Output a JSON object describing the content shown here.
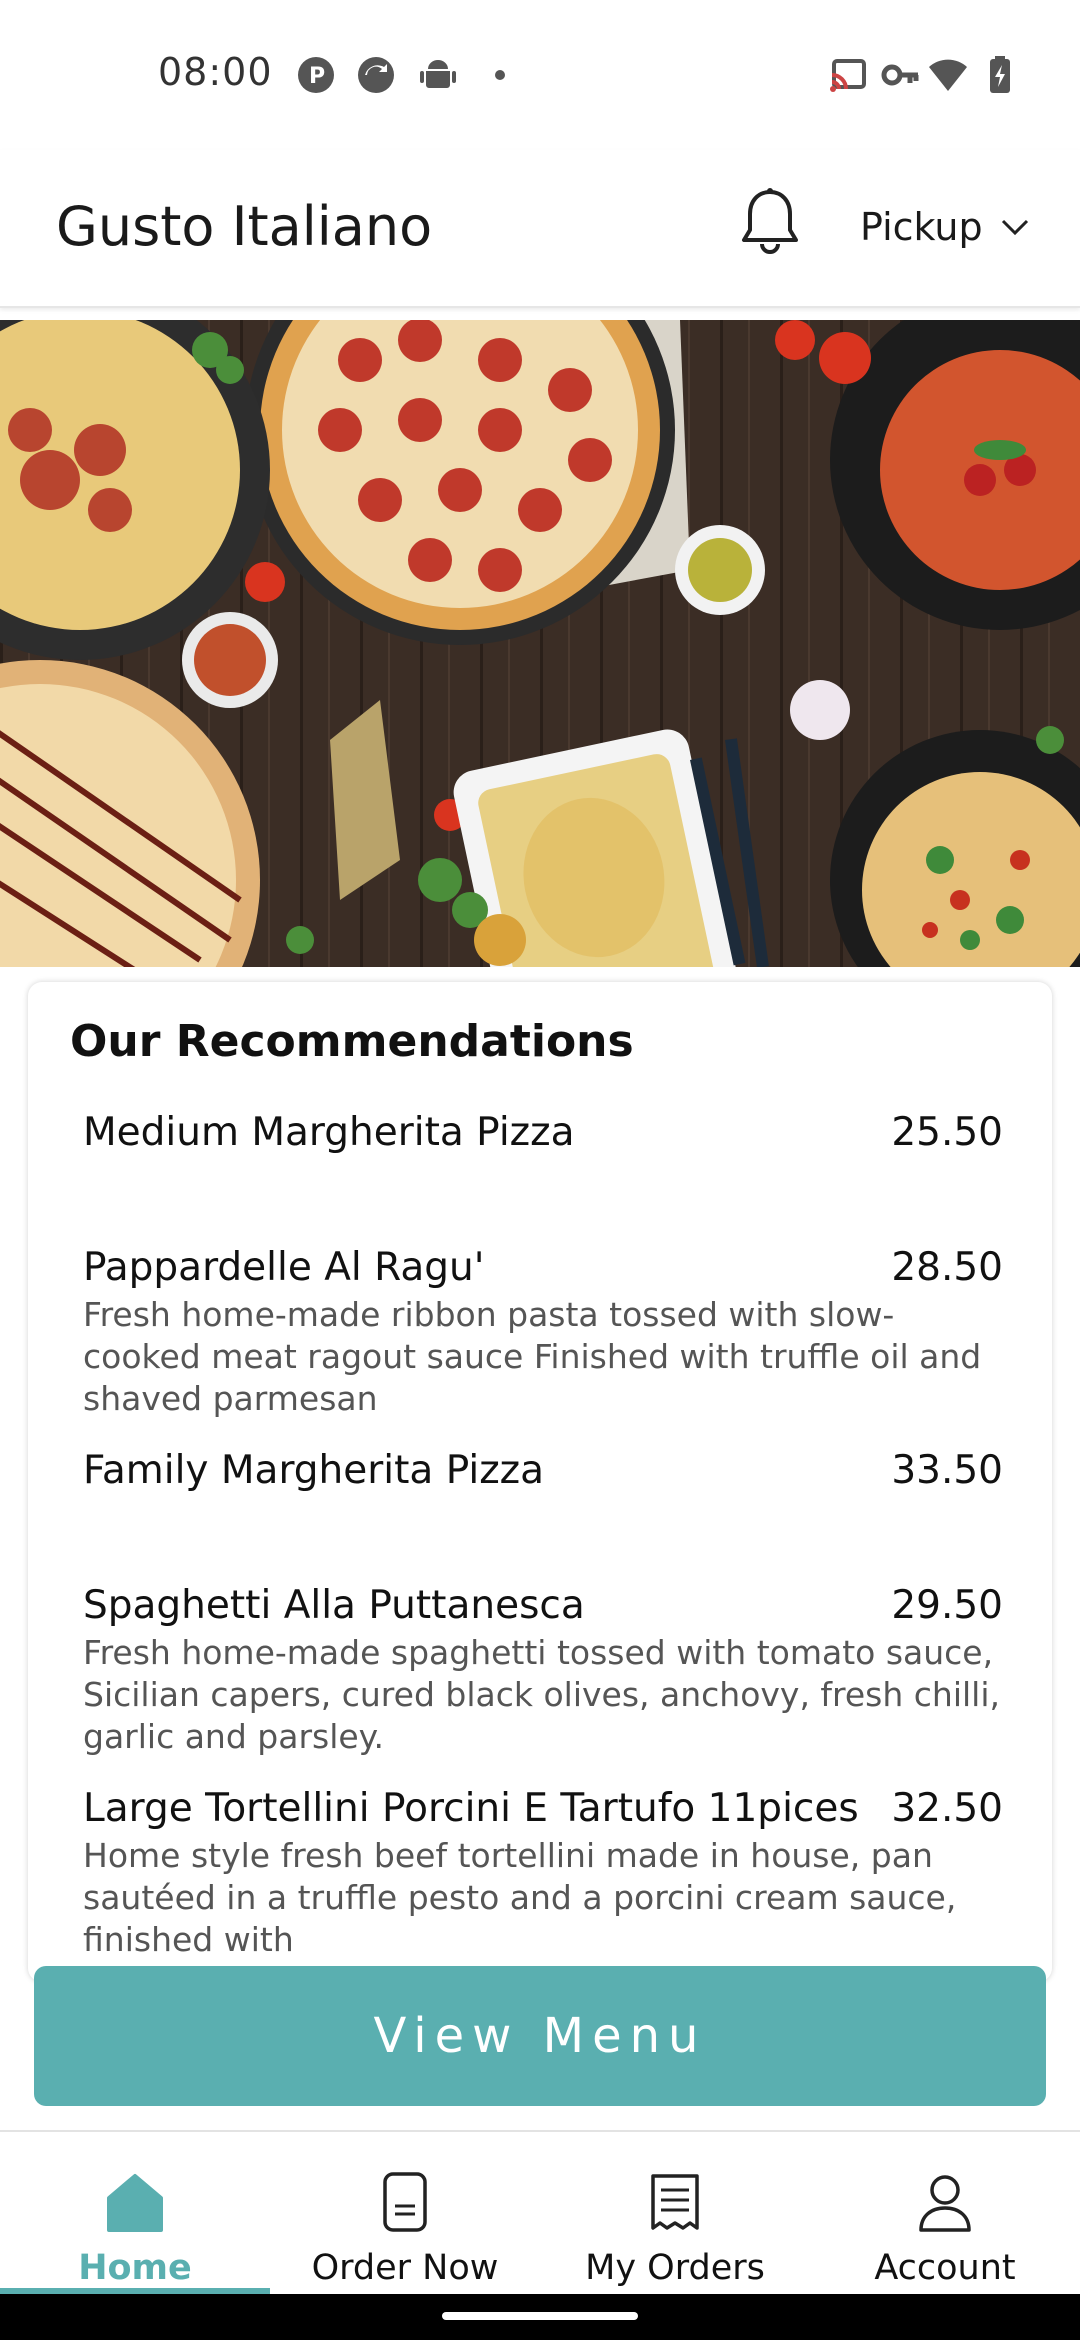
{
  "status_bar": {
    "time": "08:00",
    "left_icons": [
      "notification-p-icon",
      "sync-icon",
      "android-icon",
      "dot-icon"
    ],
    "right_icons": [
      "cast-icon",
      "vpn-key-icon",
      "wifi-icon",
      "battery-charging-icon"
    ]
  },
  "header": {
    "title": "Gusto Italiano",
    "notification_icon": "bell-icon",
    "mode_label": "Pickup",
    "mode_icon": "chevron-down-icon"
  },
  "hero": {
    "image": "italian-food-spread"
  },
  "recommendations": {
    "title": "Our Recommendations",
    "items": [
      {
        "name": "Medium Margherita Pizza",
        "price": "25.50",
        "description": ""
      },
      {
        "name": "Pappardelle Al Ragu'",
        "price": "28.50",
        "description": "Fresh home-made ribbon pasta tossed with slow-cooked meat ragout sauce Finished with truffle oil and shaved parmesan"
      },
      {
        "name": "Family Margherita Pizza",
        "price": "33.50",
        "description": ""
      },
      {
        "name": "Spaghetti Alla Puttanesca",
        "price": "29.50",
        "description": "Fresh home-made spaghetti tossed with tomato sauce, Sicilian capers, cured black olives, anchovy, fresh chilli, garlic and parsley."
      },
      {
        "name": "Large Tortellini Porcini E Tartufo 11pices",
        "price": "32.50",
        "description": "Home style fresh beef tortellini made in house, pan sautéed in a truffle pesto and a porcini cream sauce, finished with"
      }
    ]
  },
  "view_menu_button": {
    "label": "View Menu",
    "color": "#5aafb0"
  },
  "bottom_nav": {
    "items": [
      {
        "label": "Home",
        "icon": "home-icon",
        "active": true
      },
      {
        "label": "Order Now",
        "icon": "order-icon",
        "active": false
      },
      {
        "label": "My Orders",
        "icon": "receipt-icon",
        "active": false
      },
      {
        "label": "Account",
        "icon": "user-icon",
        "active": false
      }
    ],
    "accent": "#5aafb0"
  }
}
